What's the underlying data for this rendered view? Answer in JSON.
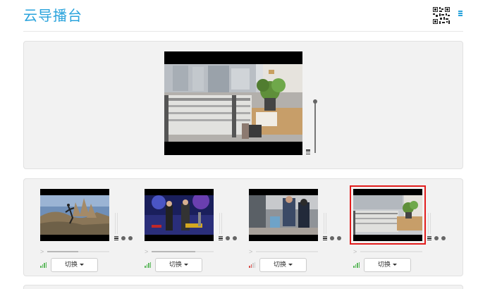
{
  "header": {
    "title": "云导播台",
    "qr_icon": "qr-code-icon",
    "menu_icon": "menu-icon"
  },
  "main": {
    "preview_icon": "program-video",
    "volume_level": 0.96
  },
  "sources": [
    {
      "switch_label": "切换",
      "progress": 0.5,
      "signal": "strong",
      "selected": false
    },
    {
      "switch_label": "切换",
      "progress": 0.7,
      "signal": "strong",
      "selected": false
    },
    {
      "switch_label": "切换",
      "progress": 0,
      "signal": "weak",
      "selected": false
    },
    {
      "switch_label": "切换",
      "progress": 0,
      "signal": "strong",
      "selected": true
    }
  ],
  "colors": {
    "accent": "#29a3dc",
    "selected_border": "#e21d1d",
    "signal_strong": "#5cb85c",
    "signal_weak": "#d9534f"
  }
}
